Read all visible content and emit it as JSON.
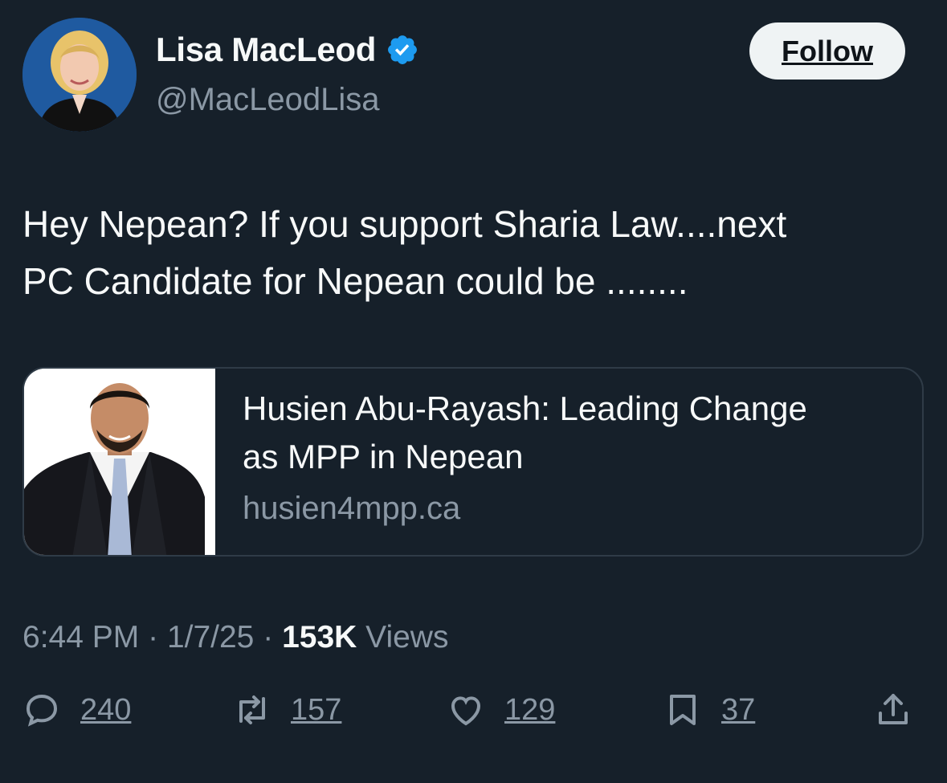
{
  "author": {
    "display_name": "Lisa MacLeod",
    "handle": "@MacLeodLisa",
    "verified": true,
    "avatar_icon": "profile-photo"
  },
  "follow_label": "Follow",
  "tweet": {
    "line1": "Hey Nepean?  If you support Sharia Law....next",
    "line2": "PC Candidate for Nepean could be ........"
  },
  "link_card": {
    "title_line1": "Husien Abu-Rayash: Leading Change",
    "title_line2": "as MPP in Nepean",
    "domain": "husien4mpp.ca",
    "thumbnail_icon": "candidate-photo"
  },
  "meta": {
    "time": "6:44 PM",
    "separator": "·",
    "date": "1/7/25",
    "views_count": "153K",
    "views_label": "Views"
  },
  "actions": {
    "replies": "240",
    "reposts": "157",
    "likes": "129",
    "bookmarks": "37"
  },
  "colors": {
    "background": "#16202a",
    "verified_badge": "#1d9bf0",
    "secondary_text": "#8b98a5",
    "follow_button": "#eff3f4"
  }
}
